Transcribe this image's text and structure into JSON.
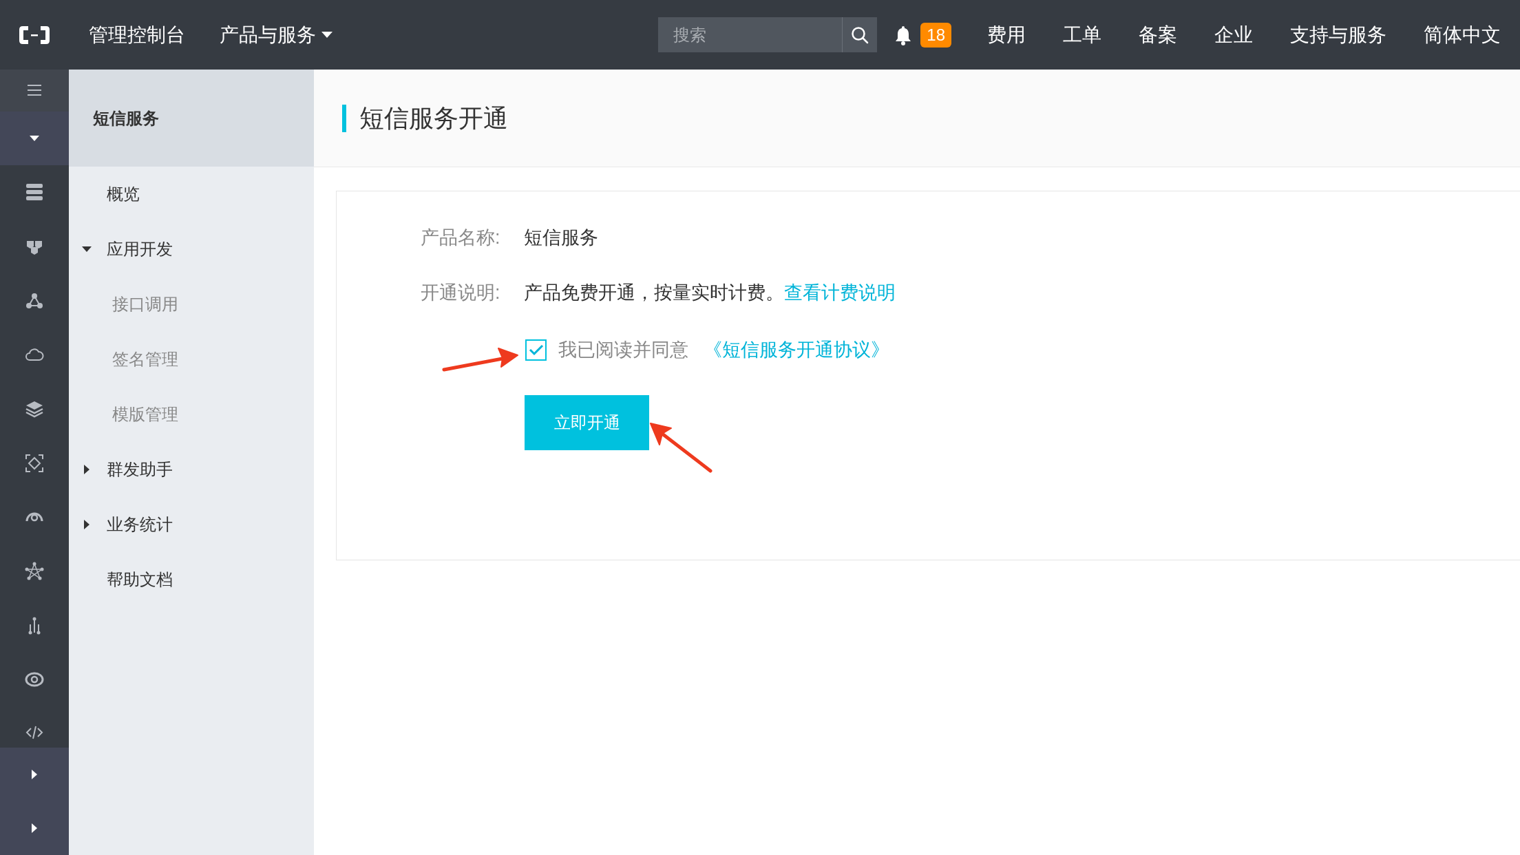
{
  "topbar": {
    "console": "管理控制台",
    "products": "产品与服务",
    "search": {
      "placeholder": "搜索"
    },
    "notifications": "18",
    "links": [
      "费用",
      "工单",
      "备案",
      "企业",
      "支持与服务",
      "简体中文"
    ]
  },
  "sidebar": {
    "title": "短信服务",
    "items": [
      {
        "label": "概览",
        "kind": "leaf"
      },
      {
        "label": "应用开发",
        "kind": "group",
        "expanded": true,
        "children": [
          {
            "label": "接口调用"
          },
          {
            "label": "签名管理"
          },
          {
            "label": "模版管理"
          }
        ]
      },
      {
        "label": "群发助手",
        "kind": "group",
        "expanded": false
      },
      {
        "label": "业务统计",
        "kind": "group",
        "expanded": false
      },
      {
        "label": "帮助文档",
        "kind": "leaf"
      }
    ]
  },
  "page": {
    "title": "短信服务开通",
    "fields": [
      {
        "label": "产品名称:",
        "value": "短信服务"
      },
      {
        "label": "开通说明:",
        "value": "产品免费开通，按量实时计费。",
        "link": "查看计费说明"
      }
    ],
    "agreement": {
      "checked": true,
      "text": "我已阅读并同意",
      "link": "《短信服务开通协议》"
    },
    "button": "立即开通"
  }
}
